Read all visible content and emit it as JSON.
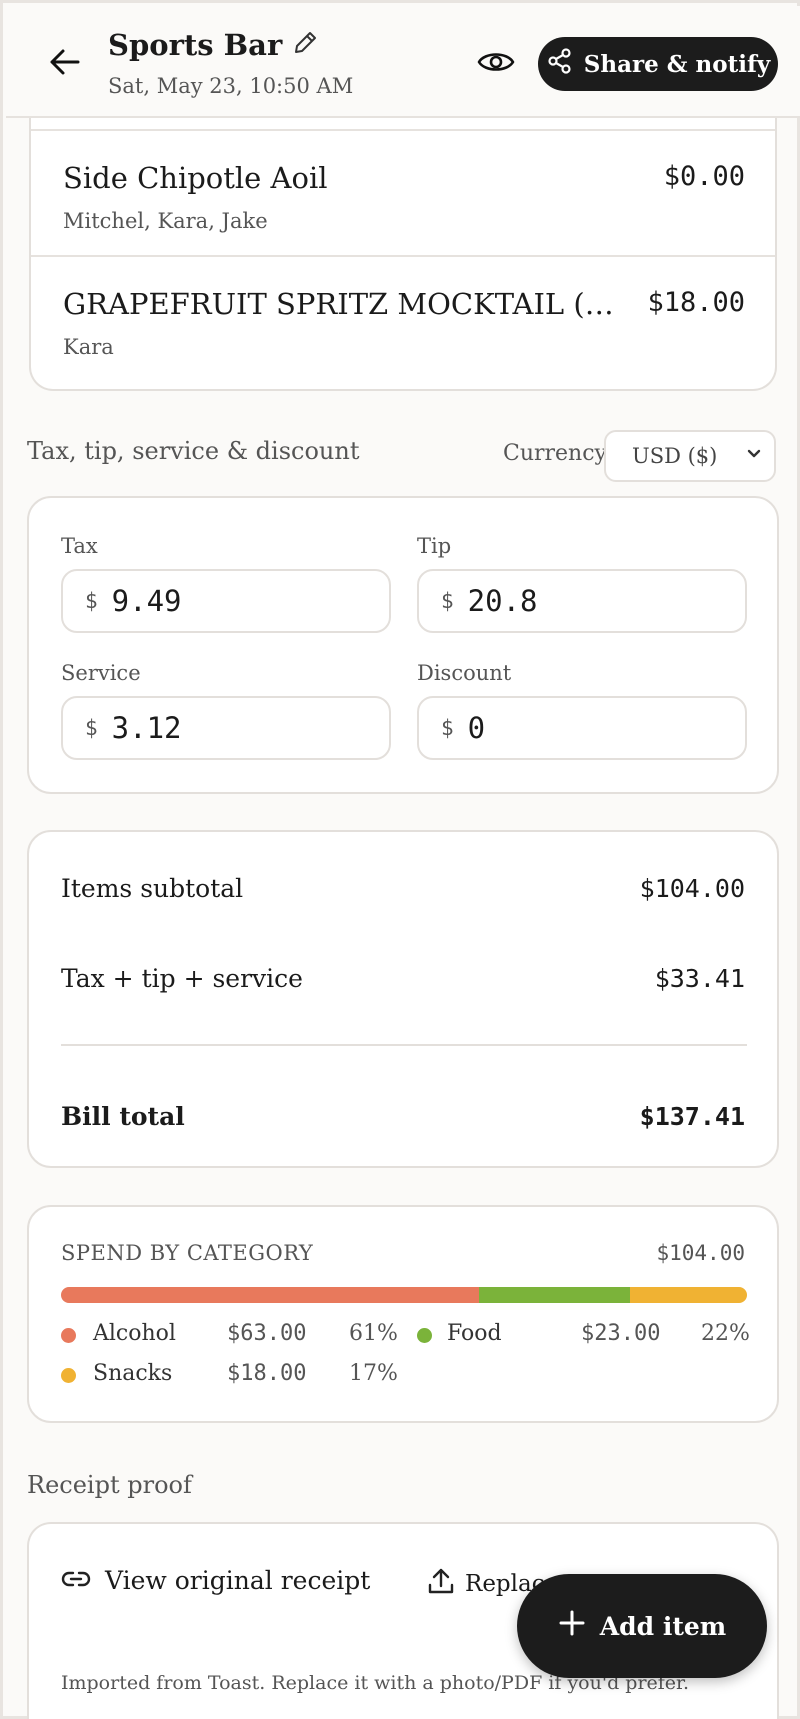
{
  "header": {
    "title": "Sports Bar",
    "subtitle": "Sat, May 23, 10:50 AM",
    "share_label": "Share & notify"
  },
  "items": [
    {
      "name": "Side Chipotle Aoil",
      "people": "Mitchel, Kara, Jake",
      "price": "$0.00"
    },
    {
      "name": "GRAPEFRUIT SPRITZ MOCKTAIL (Ti...",
      "people": "Kara",
      "price": "$18.00"
    }
  ],
  "adjustments": {
    "section_label": "Tax, tip, service & discount",
    "currency_label": "Currency",
    "currency_value": "USD ($)",
    "currency_symbol": "$",
    "tax_label": "Tax",
    "tax_value": "9.49",
    "tip_label": "Tip",
    "tip_value": "20.8",
    "service_label": "Service",
    "service_value": "3.12",
    "discount_label": "Discount",
    "discount_value": "0"
  },
  "totals": {
    "subtotal_label": "Items subtotal",
    "subtotal_value": "$104.00",
    "fees_label": "Tax + tip + service",
    "fees_value": "$33.41",
    "bill_label": "Bill total",
    "bill_value": "$137.41"
  },
  "categories": {
    "title": "SPEND BY CATEGORY",
    "total": "$104.00",
    "list": [
      {
        "name": "Alcohol",
        "amount": "$63.00",
        "pct": "61%",
        "fraction": 0.61,
        "color": "#e8795c"
      },
      {
        "name": "Food",
        "amount": "$23.00",
        "pct": "22%",
        "fraction": 0.22,
        "color": "#7bb33a"
      },
      {
        "name": "Snacks",
        "amount": "$18.00",
        "pct": "17%",
        "fraction": 0.17,
        "color": "#f0b233"
      }
    ]
  },
  "receipt": {
    "section_label": "Receipt proof",
    "view_label": "View original receipt",
    "replace_label": "Replace",
    "note": "Imported from Toast. Replace it with a photo/PDF if you'd prefer."
  },
  "fab": {
    "label": "Add item"
  },
  "icons": {
    "back": "arrow-left-icon",
    "edit": "pencil-icon",
    "preview": "eye-icon",
    "share": "share-icon",
    "dropdown": "chevron-down-icon",
    "link": "link-icon",
    "upload": "upload-icon",
    "add": "plus-icon"
  }
}
